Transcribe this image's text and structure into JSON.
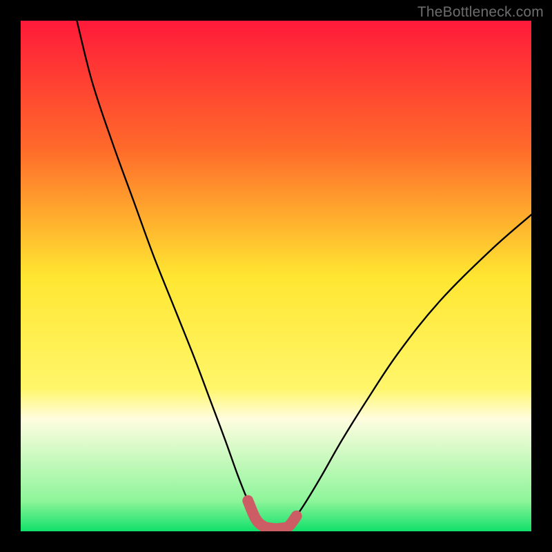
{
  "watermark": "TheBottleneck.com",
  "chart_data": {
    "type": "line",
    "title": "",
    "xlabel": "",
    "ylabel": "",
    "xlim": [
      0,
      100
    ],
    "ylim": [
      0,
      100
    ],
    "background_gradient": {
      "stops": [
        {
          "offset": 0,
          "color": "#ff1a3a"
        },
        {
          "offset": 25,
          "color": "#ff6a2a"
        },
        {
          "offset": 50,
          "color": "#ffe631"
        },
        {
          "offset": 72,
          "color": "#fff66a"
        },
        {
          "offset": 78,
          "color": "#fffde0"
        },
        {
          "offset": 94,
          "color": "#8ef59a"
        },
        {
          "offset": 100,
          "color": "#11e06a"
        }
      ]
    },
    "series": [
      {
        "name": "bottleneck-curve",
        "kind": "thin-black-line",
        "x": [
          11,
          14,
          18,
          22,
          26,
          30,
          34,
          37,
          40,
          42.5,
          44.5,
          46,
          47.5,
          49,
          50,
          51,
          52.5,
          54,
          56,
          59,
          63,
          68,
          74,
          82,
          92,
          100
        ],
        "y": [
          100,
          88,
          76,
          65,
          54,
          44,
          34,
          26,
          18,
          11,
          6,
          3,
          1.2,
          0.6,
          0.5,
          0.6,
          1.2,
          3,
          6,
          11,
          18,
          26,
          35,
          45,
          55,
          62
        ]
      },
      {
        "name": "sweet-spot-marker",
        "kind": "thick-red-segment",
        "x": [
          44.5,
          46,
          47.5,
          49,
          50,
          51,
          52.5,
          54
        ],
        "y": [
          6,
          2.5,
          1.0,
          0.6,
          0.5,
          0.6,
          1.0,
          3
        ]
      }
    ]
  }
}
